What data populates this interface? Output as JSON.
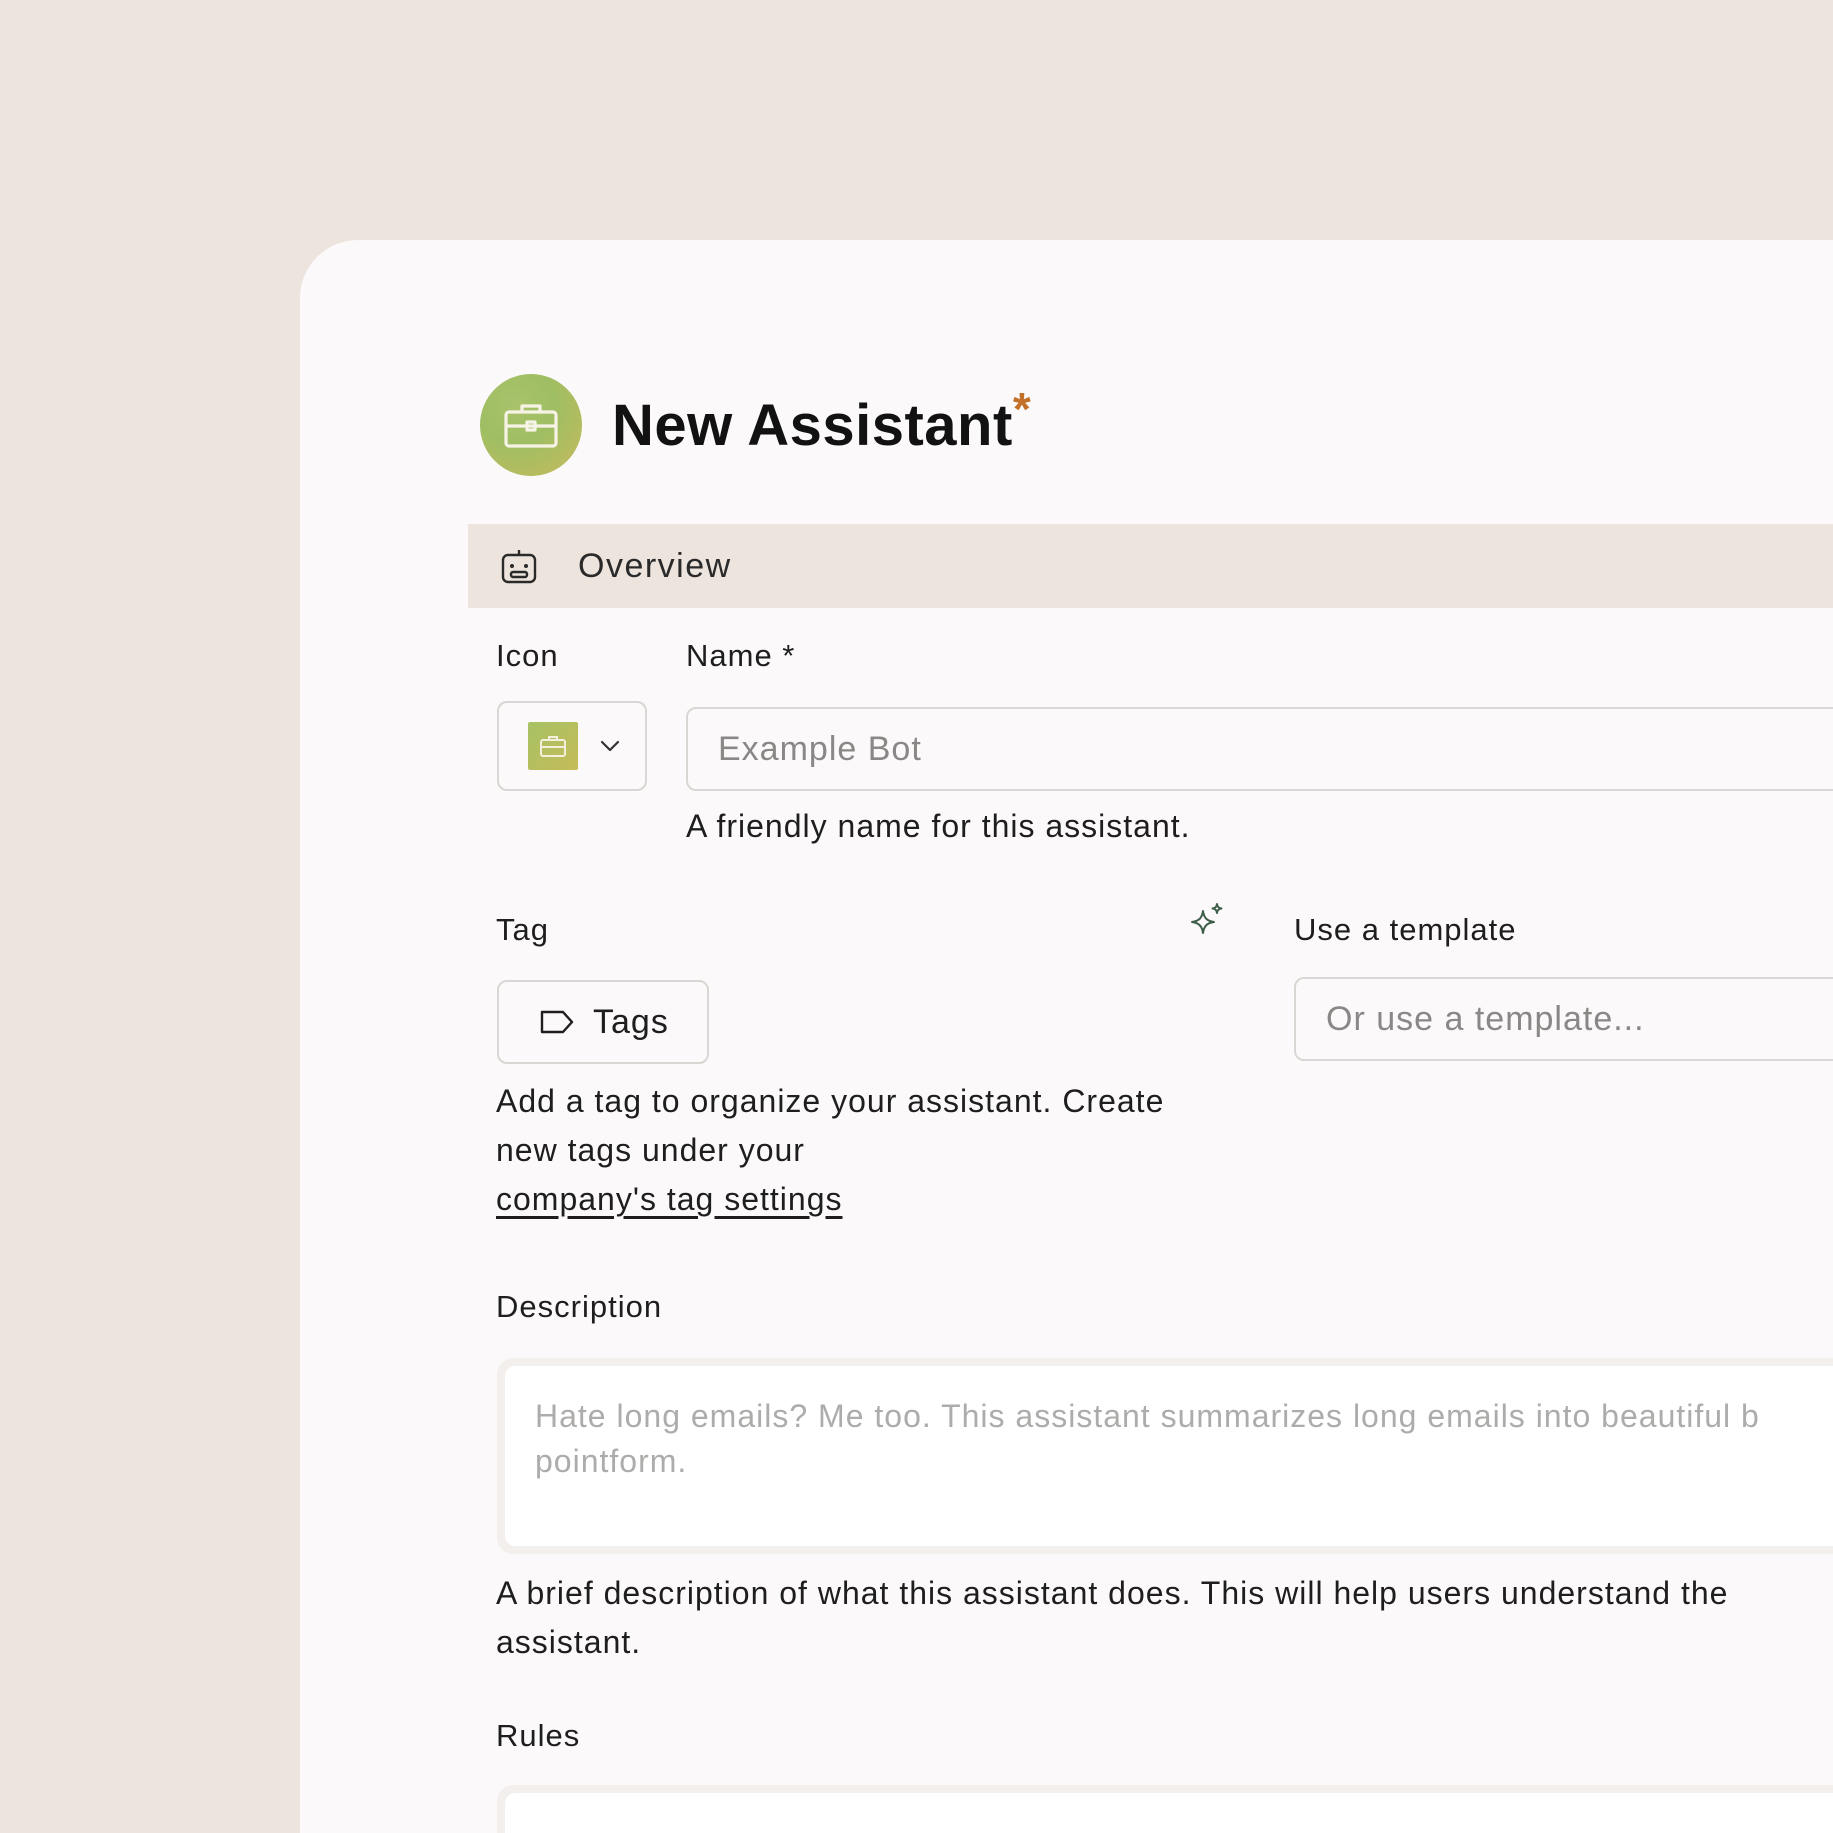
{
  "header": {
    "title": "New Assistant",
    "required_mark": "*",
    "icon": "briefcase-icon",
    "accent_color": "#c3702a"
  },
  "section": {
    "label": "Overview",
    "icon": "robot-icon"
  },
  "icon_field": {
    "label": "Icon",
    "selected_icon": "briefcase-icon"
  },
  "name_field": {
    "label": "Name *",
    "placeholder": "Example Bot",
    "helper": "A friendly name for this assistant."
  },
  "tag_field": {
    "label": "Tag",
    "button_label": "Tags",
    "helper_line1": "Add a tag to organize your assistant. Create",
    "helper_line2": "new tags under your",
    "helper_link": "company's tag settings"
  },
  "template_field": {
    "label": "Use a template",
    "placeholder": "Or use a template..."
  },
  "description_field": {
    "label": "Description",
    "placeholder": "Hate long emails? Me too. This assistant summarizes long emails into beautiful b\npointform.",
    "helper_line1": "A brief description of what this assistant does. This will help users understand the",
    "helper_line2": "assistant."
  },
  "rules_field": {
    "label": "Rules"
  }
}
